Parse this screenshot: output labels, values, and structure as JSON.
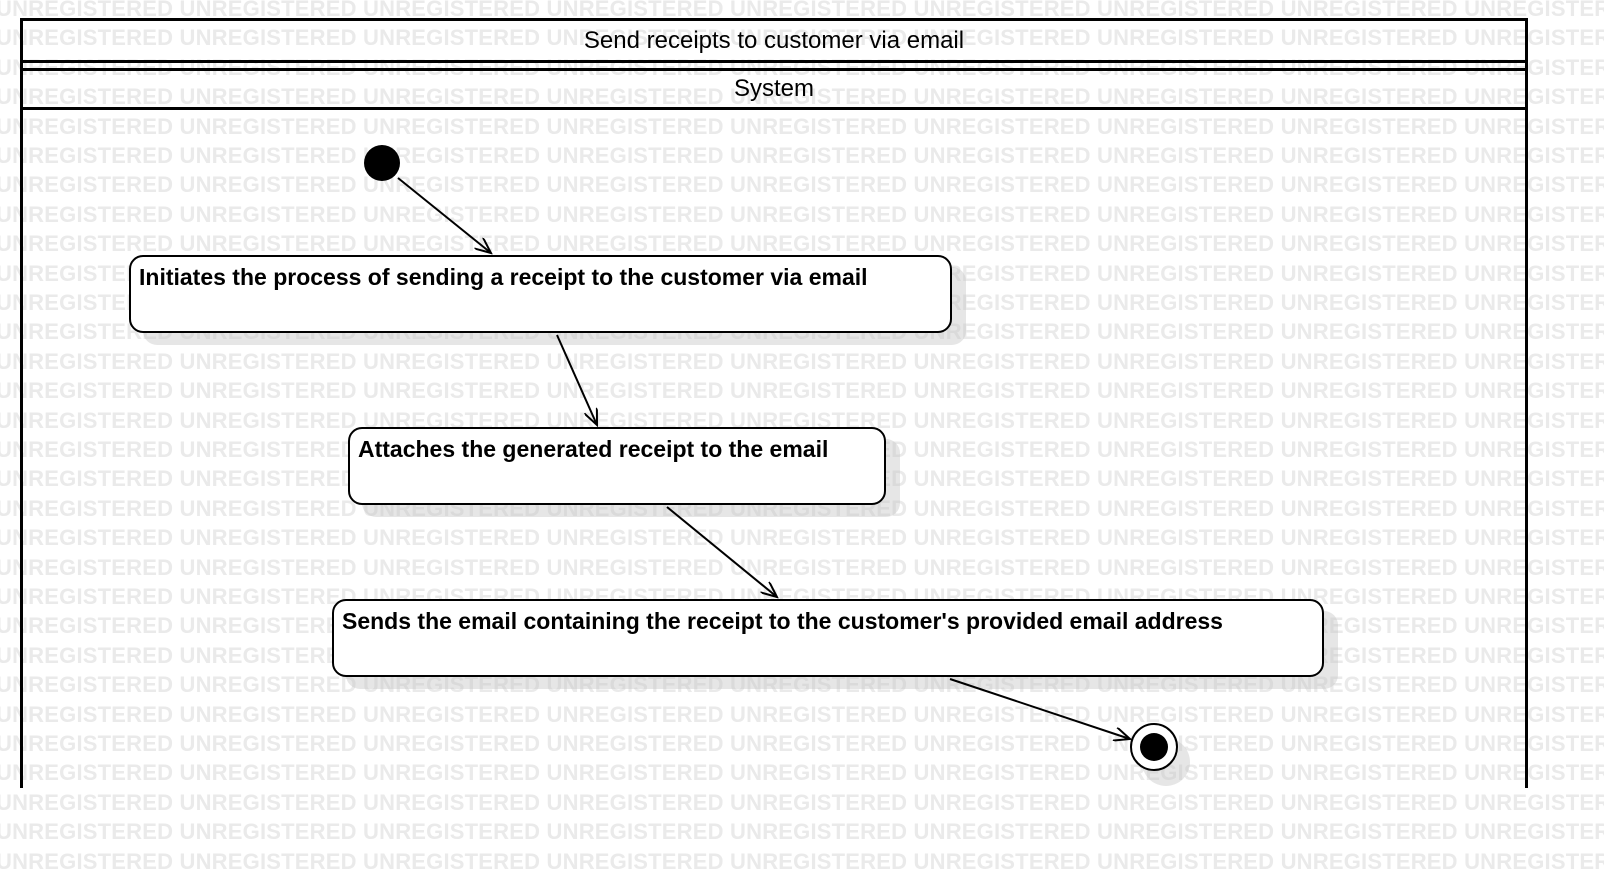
{
  "diagram": {
    "title": "Send receipts to customer via email",
    "swimlane": "System",
    "actions": [
      {
        "id": "a1",
        "label": "Initiates the process of sending a receipt to the customer via email"
      },
      {
        "id": "a2",
        "label": "Attaches the generated receipt to the email"
      },
      {
        "id": "a3",
        "label": "Sends the email containing the receipt to the customer's provided email address"
      }
    ],
    "flows": [
      {
        "from": "initial",
        "to": "a1"
      },
      {
        "from": "a1",
        "to": "a2"
      },
      {
        "from": "a2",
        "to": "a3"
      },
      {
        "from": "a3",
        "to": "final"
      }
    ]
  },
  "watermark": {
    "text": "UNREGISTERED"
  },
  "colors": {
    "line": "#000000",
    "background": "#ffffff",
    "watermark": "#eaeaea"
  }
}
